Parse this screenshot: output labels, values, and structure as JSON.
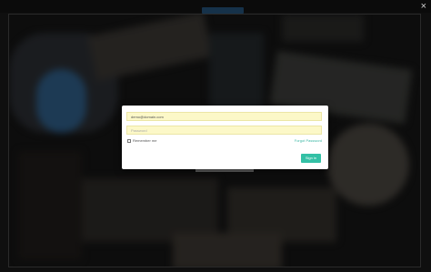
{
  "window": {
    "close_symbol": "×"
  },
  "login": {
    "email_value": "demo@domain.com",
    "password_placeholder": "Password",
    "remember_label": "Remember me",
    "forgot_label": "Forgot Password",
    "signin_label": "Sign in"
  },
  "icons": {
    "close": "close-icon",
    "checkbox": "checkbox-icon"
  },
  "colors": {
    "accent": "#33c0a5",
    "field_bg": "#fcf8c8",
    "link": "#3fb8a6"
  }
}
